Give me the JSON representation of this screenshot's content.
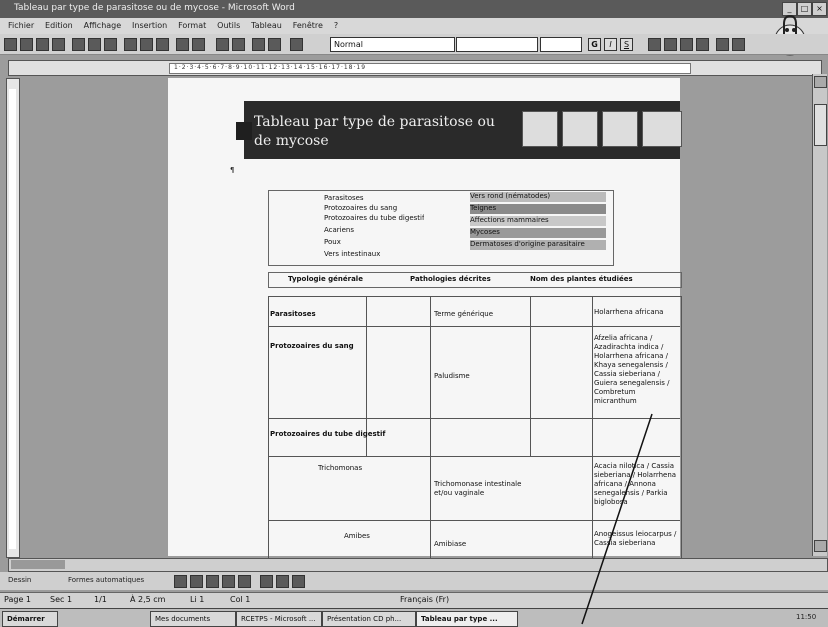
{
  "window": {
    "title": "Tableau par type de parasitose ou de mycose - Microsoft Word"
  },
  "menu": [
    "Fichier",
    "Edition",
    "Affichage",
    "Insertion",
    "Format",
    "Outils",
    "Tableau",
    "Fenêtre",
    "?"
  ],
  "toolbar": {
    "style": "Normal",
    "format_icons": [
      "G",
      "I",
      "S"
    ]
  },
  "ruler_text": "1·2·3·4·5·6·7·8·9·10·11·12·13·14·15·16·17·18·19",
  "document": {
    "header_title": "Tableau par type de parasitose ou de mycose",
    "para_mark": "¶",
    "legend_left": [
      "Parasitoses",
      "Protozoaires du sang",
      "Protozoaires du tube digestif",
      "Acariens",
      "Poux",
      "Vers intestinaux"
    ],
    "legend_right": [
      "Vers rond (nématodes)",
      "Teignes",
      "Affections mammaires",
      "Mycoses",
      "Dermatoses d'origine parasitaire"
    ],
    "columns": [
      "Typologie générale",
      "Pathologies décrites",
      "Nom des plantes étudiées"
    ],
    "rows": [
      {
        "type": "Parasitoses",
        "generic": "Terme générique",
        "plants": "Holarrhena africana"
      },
      {
        "type": "Protozoaires du sang",
        "generic": "Paludisme",
        "plants": "Afzelia africana / Azadirachta indica / Holarrhena africana / Khaya senegalensis / Cassia sieberiana / Guiera senegalensis / Combretum micranthum"
      },
      {
        "type": "Protozoaires du tube digestif",
        "generic": "",
        "plants": ""
      },
      {
        "type": "Trichomonas",
        "generic": "Trichomonase intestinale et/ou vaginale",
        "plants": "Acacia nilotica / Cassia sieberiana / Holarrhena africana / Annona senegalensis / Parkia biglobosa"
      },
      {
        "type": "Amibes",
        "generic": "Amibiase",
        "plants": "Anogeissus leiocarpus / Cassia sieberiana"
      }
    ]
  },
  "drawbar": {
    "draw": "Dessin",
    "autoshapes": "Formes automatiques"
  },
  "status": {
    "page": "Page 1",
    "sec": "Sec 1",
    "pages": "1/1",
    "at": "À 2,5 cm",
    "line": "Li 1",
    "col": "Col 1",
    "lang": "Français (Fr)"
  },
  "taskbar": [
    {
      "label": "Démarrer"
    },
    {
      "label": "Mes documents"
    },
    {
      "label": "RCETPS - Microsoft ..."
    },
    {
      "label": "Présentation CD ph..."
    },
    {
      "label": "Tableau par type ..."
    }
  ],
  "clock": "11:50"
}
